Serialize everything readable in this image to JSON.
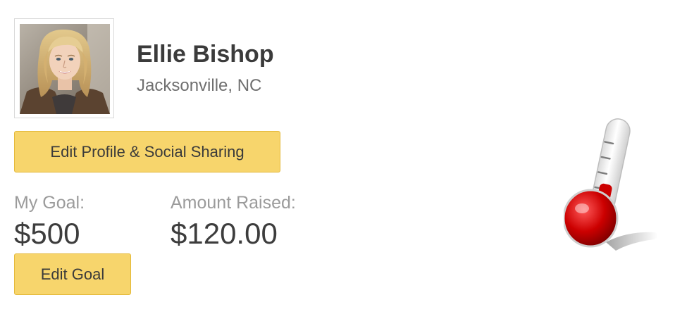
{
  "profile": {
    "name": "Ellie Bishop",
    "location": "Jacksonville, NC"
  },
  "buttons": {
    "edit_profile": "Edit Profile & Social Sharing",
    "edit_goal": "Edit Goal"
  },
  "stats": {
    "goal_label": "My Goal:",
    "goal_value": "$500",
    "raised_label": "Amount Raised:",
    "raised_value": "$120.00"
  },
  "progress": {
    "fraction": 0.24,
    "fill_color": "#cc0000"
  },
  "icons": {
    "thermometer": "thermometer-icon"
  }
}
